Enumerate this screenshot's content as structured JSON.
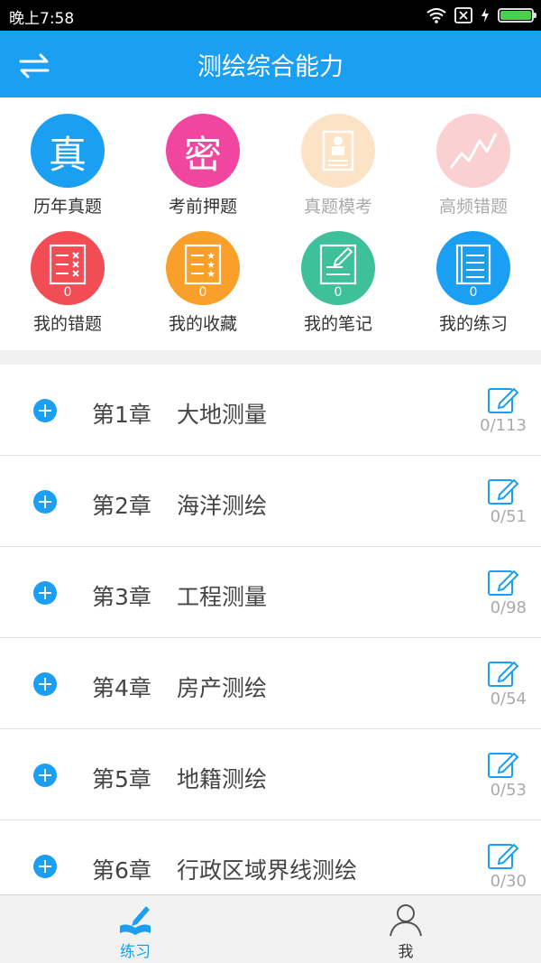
{
  "status_bar": {
    "time": "晚上7:58",
    "battery_level": 1.0
  },
  "header": {
    "title": "测绘综合能力",
    "left_icon": "switch-arrows-icon"
  },
  "grid": [
    {
      "label": "历年真题",
      "glyph": "真",
      "color": "#1a9ff3",
      "dim": false,
      "icon": "book-icon"
    },
    {
      "label": "考前押题",
      "glyph": "密",
      "color": "#f046a0",
      "dim": false,
      "icon": "secret-icon"
    },
    {
      "label": "真题模考",
      "glyph": "",
      "color": "#fde3c6",
      "dim": true,
      "icon": "exam-paper-icon"
    },
    {
      "label": "高频错题",
      "glyph": "",
      "color": "#fbd0d0",
      "dim": true,
      "icon": "trend-icon"
    },
    {
      "label": "我的错题",
      "count": "0",
      "color": "#f24c55",
      "dim": false,
      "icon": "wrong-list-icon"
    },
    {
      "label": "我的收藏",
      "count": "0",
      "color": "#f8a02a",
      "dim": false,
      "icon": "star-list-icon"
    },
    {
      "label": "我的笔记",
      "count": "0",
      "color": "#3ec09b",
      "dim": false,
      "icon": "note-icon"
    },
    {
      "label": "我的练习",
      "count": "0",
      "color": "#1a9ff3",
      "dim": false,
      "icon": "practice-book-icon"
    }
  ],
  "chapters": [
    {
      "number": "第1章",
      "title": "大地测量",
      "progress": "0/113"
    },
    {
      "number": "第2章",
      "title": "海洋测绘",
      "progress": "0/51"
    },
    {
      "number": "第3章",
      "title": "工程测量",
      "progress": "0/98"
    },
    {
      "number": "第4章",
      "title": "房产测绘",
      "progress": "0/54"
    },
    {
      "number": "第5章",
      "title": "地籍测绘",
      "progress": "0/53"
    },
    {
      "number": "第6章",
      "title": "行政区域界线测绘",
      "progress": "0/30"
    }
  ],
  "bottom_nav": [
    {
      "label": "练习",
      "active": true,
      "icon": "pen-book-icon"
    },
    {
      "label": "我",
      "active": false,
      "icon": "person-icon"
    }
  ],
  "colors": {
    "accent": "#1a9ff3",
    "header_bg": "#1a9ff3"
  }
}
